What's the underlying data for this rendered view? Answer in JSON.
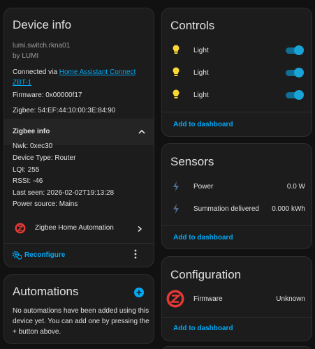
{
  "device_info": {
    "title": "Device info",
    "model": "lumi.switch.rkna01",
    "manufacturer": "by LUMI",
    "connected_prefix": "Connected via ",
    "connected_link": "Home Assistant Connect ZBT-1",
    "firmware": "Firmware: 0x00000f17",
    "zigbee": "Zigbee: 54:EF:44:10:00:3E:84:90",
    "zigbee_info": {
      "title": "Zigbee info",
      "nwk": "Nwk: 0xec30",
      "device_type": "Device Type: Router",
      "lqi": "LQI: 255",
      "rssi": "RSSI: -46",
      "last_seen": "Last seen: 2026-02-02T19:13:28",
      "power_source": "Power source: Mains"
    },
    "integration": "Zigbee Home Automation",
    "reconfigure": "Reconfigure"
  },
  "automations": {
    "title": "Automations",
    "empty_text": "No automations have been added using this device yet. You can add one by pressing the + button above."
  },
  "controls": {
    "title": "Controls",
    "items": [
      {
        "label": "Light",
        "state": "on"
      },
      {
        "label": "Light",
        "state": "on"
      },
      {
        "label": "Light",
        "state": "on"
      }
    ],
    "add_to_dashboard": "Add to dashboard"
  },
  "sensors": {
    "title": "Sensors",
    "items": [
      {
        "label": "Power",
        "value": "0.0 W"
      },
      {
        "label": "Summation delivered",
        "value": "0.000 kWh"
      }
    ],
    "add_to_dashboard": "Add to dashboard"
  },
  "configuration": {
    "title": "Configuration",
    "items": [
      {
        "label": "Firmware",
        "value": "Unknown"
      }
    ],
    "add_to_dashboard": "Add to dashboard"
  },
  "colors": {
    "background": "#111111",
    "card": "#1c1c1c",
    "accent": "#03a9f4",
    "bulb": "#fdd835",
    "zha_red": "#e53935"
  }
}
